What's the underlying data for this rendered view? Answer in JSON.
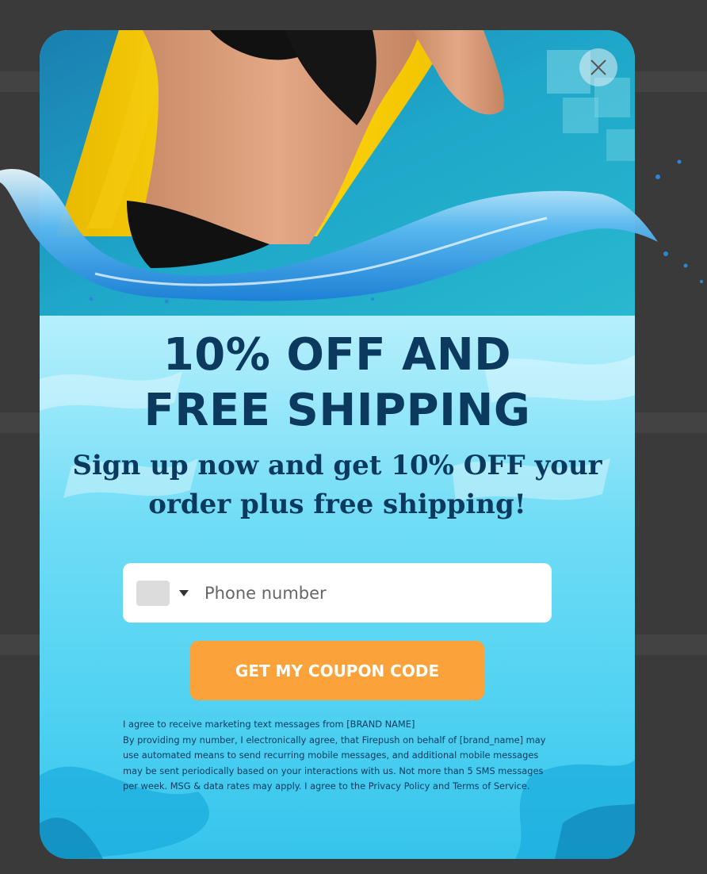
{
  "popup": {
    "close_icon": "close-icon",
    "headline_line1": "10% OFF AND",
    "headline_line2": "FREE SHIPPING",
    "subhead": "Sign up now and get 10% OFF your order plus free shipping!",
    "phone": {
      "placeholder": "Phone number",
      "value": "",
      "country_flag_icon": "flag-placeholder-icon",
      "dropdown_icon": "caret-down-icon"
    },
    "cta_label": "GET MY COUPON CODE",
    "legal": {
      "line1": "I agree to receive marketing text messages from [BRAND NAME]",
      "line2_text": "By providing my number, I electronically agree, that Firepush on behalf of [brand_name] may use automated means to send recurring mobile messages, and additional mobile messages may be sent periodically based on your interactions with us. Not more than 5 SMS messages per week. MSG & data rates may apply. I agree to the",
      "privacy_link": "Privacy Policy",
      "and": "and",
      "terms_link": "Terms of Service",
      "period": "."
    }
  },
  "colors": {
    "headline": "#0b3a5e",
    "cta_background": "#fba33a",
    "backdrop": "#3a3a3a",
    "water_light": "#c6f3fd",
    "water_deep": "#36c4ec"
  }
}
